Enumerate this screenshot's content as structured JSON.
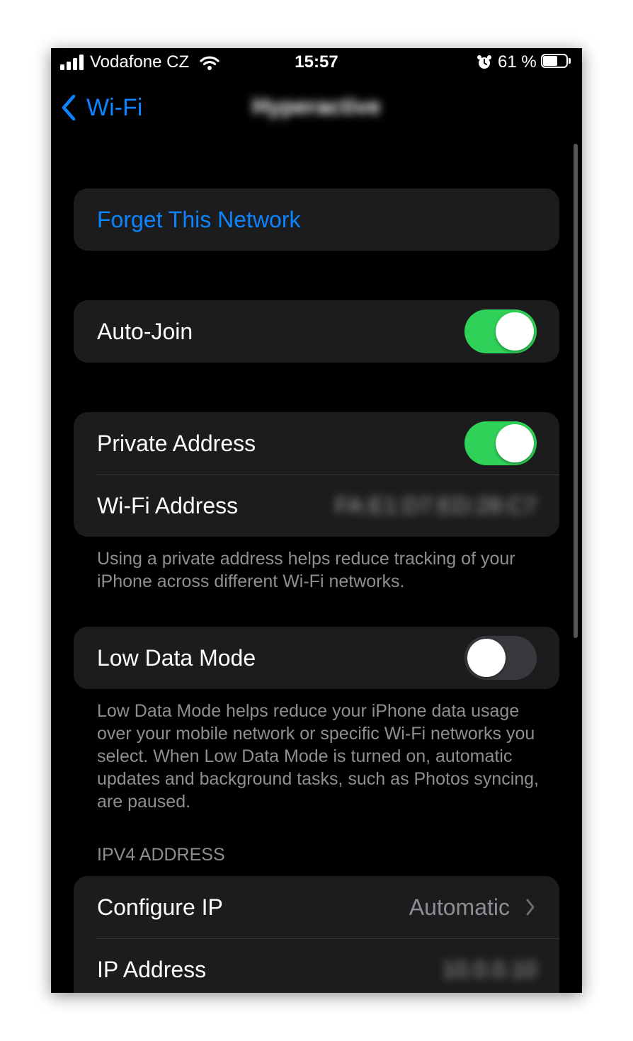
{
  "status_bar": {
    "carrier": "Vodafone CZ",
    "time": "15:57",
    "battery_percent": "61 %",
    "battery_level": 0.61
  },
  "nav": {
    "back_label": "Wi-Fi",
    "title": "Hyperactive"
  },
  "forget": {
    "label": "Forget This Network"
  },
  "auto_join": {
    "label": "Auto-Join",
    "on": true
  },
  "private_address": {
    "label": "Private Address",
    "on": true,
    "wifi_address_label": "Wi-Fi Address",
    "wifi_address_value": "FA:E1:D7:ED:28:C7",
    "footer": "Using a private address helps reduce tracking of your iPhone across different Wi-Fi networks."
  },
  "low_data_mode": {
    "label": "Low Data Mode",
    "on": false,
    "footer": "Low Data Mode helps reduce your iPhone data usage over your mobile network or specific Wi-Fi networks you select. When Low Data Mode is turned on, automatic updates and background tasks, such as Photos syncing, are paused."
  },
  "ipv4": {
    "header": "IPV4 ADDRESS",
    "configure_label": "Configure IP",
    "configure_value": "Automatic",
    "ip_label": "IP Address",
    "ip_value": "10.0.0.10"
  },
  "colors": {
    "accent": "#0a84ff",
    "toggle_on": "#30d158",
    "background": "#000000",
    "cell": "#1c1c1e"
  }
}
